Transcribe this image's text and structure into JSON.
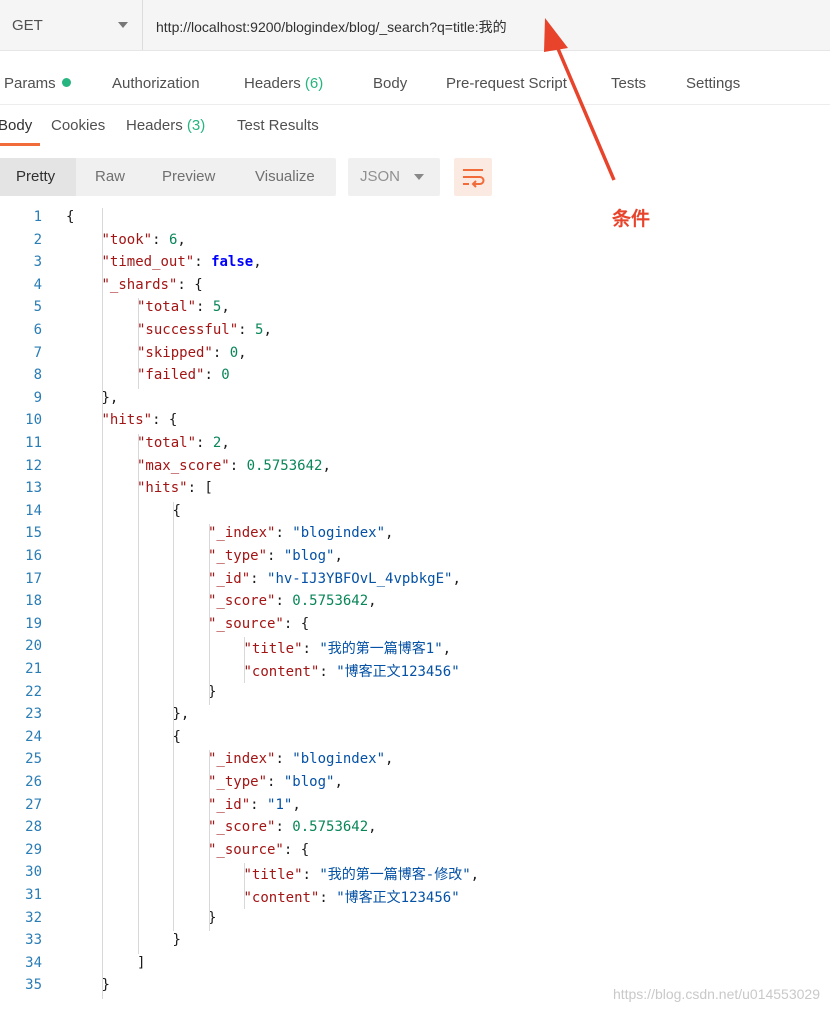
{
  "request": {
    "method": "GET",
    "url": "http://localhost:9200/blogindex/blog/_search?q=title:我的"
  },
  "request_tabs": [
    {
      "label": "Params",
      "indicator": "green-dot"
    },
    {
      "label": "Authorization"
    },
    {
      "label": "Headers",
      "count": "(6)"
    },
    {
      "label": "Body"
    },
    {
      "label": "Pre-request Script"
    },
    {
      "label": "Tests"
    },
    {
      "label": "Settings"
    }
  ],
  "response_tabs": [
    {
      "label": "Body",
      "active": true
    },
    {
      "label": "Cookies"
    },
    {
      "label": "Headers",
      "count": "(3)"
    },
    {
      "label": "Test Results"
    }
  ],
  "view_modes": [
    "Pretty",
    "Raw",
    "Preview",
    "Visualize"
  ],
  "active_view": "Pretty",
  "format": "JSON",
  "annotation": {
    "label": "条件",
    "color": "#e8432b"
  },
  "code_lines": [
    [
      [
        "p",
        "{"
      ]
    ],
    [
      [
        "k",
        "\"took\""
      ],
      [
        "p",
        ": "
      ],
      [
        "n",
        "6"
      ],
      [
        "p",
        ","
      ]
    ],
    [
      [
        "k",
        "\"timed_out\""
      ],
      [
        "p",
        ": "
      ],
      [
        "b",
        "false"
      ],
      [
        "p",
        ","
      ]
    ],
    [
      [
        "k",
        "\"_shards\""
      ],
      [
        "p",
        ": {"
      ]
    ],
    [
      [
        "k",
        "\"total\""
      ],
      [
        "p",
        ": "
      ],
      [
        "n",
        "5"
      ],
      [
        "p",
        ","
      ]
    ],
    [
      [
        "k",
        "\"successful\""
      ],
      [
        "p",
        ": "
      ],
      [
        "n",
        "5"
      ],
      [
        "p",
        ","
      ]
    ],
    [
      [
        "k",
        "\"skipped\""
      ],
      [
        "p",
        ": "
      ],
      [
        "n",
        "0"
      ],
      [
        "p",
        ","
      ]
    ],
    [
      [
        "k",
        "\"failed\""
      ],
      [
        "p",
        ": "
      ],
      [
        "n",
        "0"
      ]
    ],
    [
      [
        "p",
        "},"
      ]
    ],
    [
      [
        "k",
        "\"hits\""
      ],
      [
        "p",
        ": {"
      ]
    ],
    [
      [
        "k",
        "\"total\""
      ],
      [
        "p",
        ": "
      ],
      [
        "n",
        "2"
      ],
      [
        "p",
        ","
      ]
    ],
    [
      [
        "k",
        "\"max_score\""
      ],
      [
        "p",
        ": "
      ],
      [
        "n",
        "0.5753642"
      ],
      [
        "p",
        ","
      ]
    ],
    [
      [
        "k",
        "\"hits\""
      ],
      [
        "p",
        ": ["
      ]
    ],
    [
      [
        "p",
        "{"
      ]
    ],
    [
      [
        "k",
        "\"_index\""
      ],
      [
        "p",
        ": "
      ],
      [
        "s",
        "\"blogindex\""
      ],
      [
        "p",
        ","
      ]
    ],
    [
      [
        "k",
        "\"_type\""
      ],
      [
        "p",
        ": "
      ],
      [
        "s",
        "\"blog\""
      ],
      [
        "p",
        ","
      ]
    ],
    [
      [
        "k",
        "\"_id\""
      ],
      [
        "p",
        ": "
      ],
      [
        "s",
        "\"hv-IJ3YBFOvL_4vpbkgE\""
      ],
      [
        "p",
        ","
      ]
    ],
    [
      [
        "k",
        "\"_score\""
      ],
      [
        "p",
        ": "
      ],
      [
        "n",
        "0.5753642"
      ],
      [
        "p",
        ","
      ]
    ],
    [
      [
        "k",
        "\"_source\""
      ],
      [
        "p",
        ": {"
      ]
    ],
    [
      [
        "k",
        "\"title\""
      ],
      [
        "p",
        ": "
      ],
      [
        "s",
        "\"我的第一篇博客1\""
      ],
      [
        "p",
        ","
      ]
    ],
    [
      [
        "k",
        "\"content\""
      ],
      [
        "p",
        ": "
      ],
      [
        "s",
        "\"博客正文123456\""
      ]
    ],
    [
      [
        "p",
        "}"
      ]
    ],
    [
      [
        "p",
        "},"
      ]
    ],
    [
      [
        "p",
        "{"
      ]
    ],
    [
      [
        "k",
        "\"_index\""
      ],
      [
        "p",
        ": "
      ],
      [
        "s",
        "\"blogindex\""
      ],
      [
        "p",
        ","
      ]
    ],
    [
      [
        "k",
        "\"_type\""
      ],
      [
        "p",
        ": "
      ],
      [
        "s",
        "\"blog\""
      ],
      [
        "p",
        ","
      ]
    ],
    [
      [
        "k",
        "\"_id\""
      ],
      [
        "p",
        ": "
      ],
      [
        "s",
        "\"1\""
      ],
      [
        "p",
        ","
      ]
    ],
    [
      [
        "k",
        "\"_score\""
      ],
      [
        "p",
        ": "
      ],
      [
        "n",
        "0.5753642"
      ],
      [
        "p",
        ","
      ]
    ],
    [
      [
        "k",
        "\"_source\""
      ],
      [
        "p",
        ": {"
      ]
    ],
    [
      [
        "k",
        "\"title\""
      ],
      [
        "p",
        ": "
      ],
      [
        "s",
        "\"我的第一篇博客-修改\""
      ],
      [
        "p",
        ","
      ]
    ],
    [
      [
        "k",
        "\"content\""
      ],
      [
        "p",
        ": "
      ],
      [
        "s",
        "\"博客正文123456\""
      ]
    ],
    [
      [
        "p",
        "}"
      ]
    ],
    [
      [
        "p",
        "}"
      ]
    ],
    [
      [
        "p",
        "]"
      ]
    ],
    [
      [
        "p",
        "}"
      ]
    ]
  ],
  "code_indents": [
    0,
    1,
    1,
    1,
    2,
    2,
    2,
    2,
    1,
    1,
    2,
    2,
    2,
    3,
    4,
    4,
    4,
    4,
    4,
    5,
    5,
    4,
    3,
    3,
    4,
    4,
    4,
    4,
    4,
    5,
    5,
    4,
    3,
    2,
    1
  ],
  "watermark": "https://blog.csdn.net/u014553029"
}
